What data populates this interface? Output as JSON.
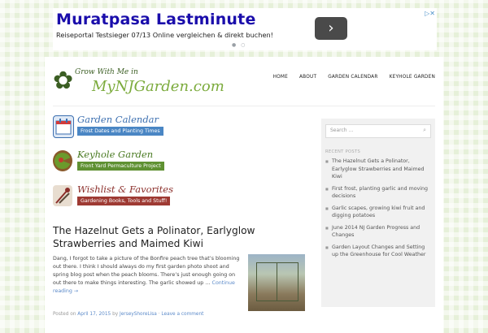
{
  "ad": {
    "title": "Muratpasa Lastminute",
    "subtitle": "Reiseportal Testsieger 07/13 Online vergleichen & direkt buchen!",
    "arrow": "›",
    "adchoices": "▷✕"
  },
  "logo": {
    "top_text": "Grow With Me in",
    "main_text": "MyNJGarden.com",
    "flower": "✿"
  },
  "nav": [
    "HOME",
    "ABOUT",
    "GARDEN CALENDAR",
    "KEYHOLE GARDEN"
  ],
  "features": [
    {
      "title": "Garden Calendar",
      "subtitle": "Frost Dates and Planting Times",
      "color": "#3c6fb0",
      "sub_bg": "#4a86c4",
      "icon": "calendar-icon"
    },
    {
      "title": "Keyhole Garden",
      "subtitle": "Front Yard Permaculture Project",
      "color": "#4a7a22",
      "sub_bg": "#5f9132",
      "icon": "keyhole-garden-icon"
    },
    {
      "title": "Wishlist & Favorites",
      "subtitle": "Gardening Books, Tools and Stuff!",
      "color": "#8b2e2a",
      "sub_bg": "#9e3a33",
      "icon": "tools-icon"
    }
  ],
  "post": {
    "title": "The Hazelnut Gets a Polinator, Earlyglow Strawberries and Maimed Kiwi",
    "excerpt": "Dang, I forgot to take a picture of the Bonfire peach tree that’s blooming out there. I think I should always do my first garden photo shoot and spring blog post when the peach blooms. There’s just enough going on out there to make things interesting. The garlic showed up …",
    "continue": "Continue reading →",
    "meta_prefix": "Posted on",
    "date": "April 17, 2015",
    "by": "by",
    "author": "JerseyShoreLisa",
    "comment": "Leave a comment"
  },
  "sidebar": {
    "search_placeholder": "Search …",
    "recent_heading": "RECENT POSTS",
    "recent_posts": [
      "The Hazelnut Gets a Polinator, Earlyglow Strawberries and Maimed Kiwi",
      "First frost, planting garlic and moving decisions",
      "Garlic scapes, growing kiwi fruit and digging potatoes",
      "June 2014 NJ Garden Progress and Changes",
      "Garden Layout Changes and Setting up the Greenhouse for Cool Weather"
    ]
  }
}
